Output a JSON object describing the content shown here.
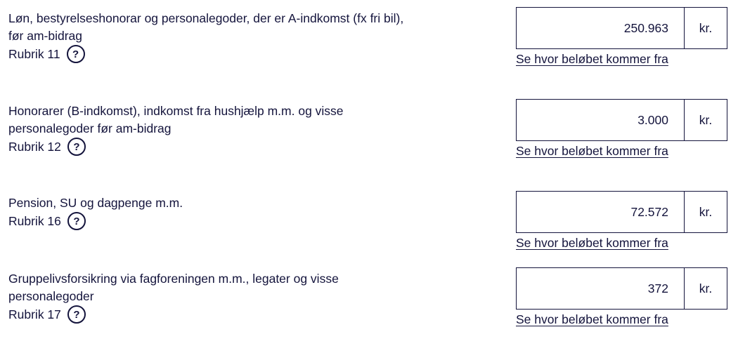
{
  "rows": [
    {
      "label_lines": [
        "Løn, bestyrelseshonorar og personalegoder, der er A-indkomst (fx fri bil),",
        "før am-bidrag"
      ],
      "rubrik": "Rubrik 11",
      "help_glyph": "?",
      "help_icon": "question-circle-icon",
      "amount": "250.963",
      "unit": "kr.",
      "link": "Se hvor beløbet kommer fra"
    },
    {
      "label_lines": [
        "Honorarer (B-indkomst), indkomst fra hushjælp m.m. og visse",
        "personalegoder før am-bidrag"
      ],
      "rubrik": "Rubrik 12",
      "help_glyph": "?",
      "help_icon": "question-circle-icon",
      "amount": "3.000",
      "unit": "kr.",
      "link": "Se hvor beløbet kommer fra"
    },
    {
      "label_lines": [
        "Pension, SU og dagpenge m.m."
      ],
      "rubrik": "Rubrik 16",
      "help_glyph": "?",
      "help_icon": "question-circle-icon",
      "amount": "72.572",
      "unit": "kr.",
      "link": "Se hvor beløbet kommer fra"
    },
    {
      "label_lines": [
        "Gruppelivsforsikring via fagforeningen m.m., legater og visse",
        "personalegoder"
      ],
      "rubrik": "Rubrik 17",
      "help_glyph": "?",
      "help_icon": "question-circle-icon",
      "amount": "372",
      "unit": "kr.",
      "link": "Se hvor beløbet kommer fra"
    }
  ],
  "colors": {
    "text": "#14143c",
    "border": "#14143c",
    "background": "#ffffff"
  }
}
